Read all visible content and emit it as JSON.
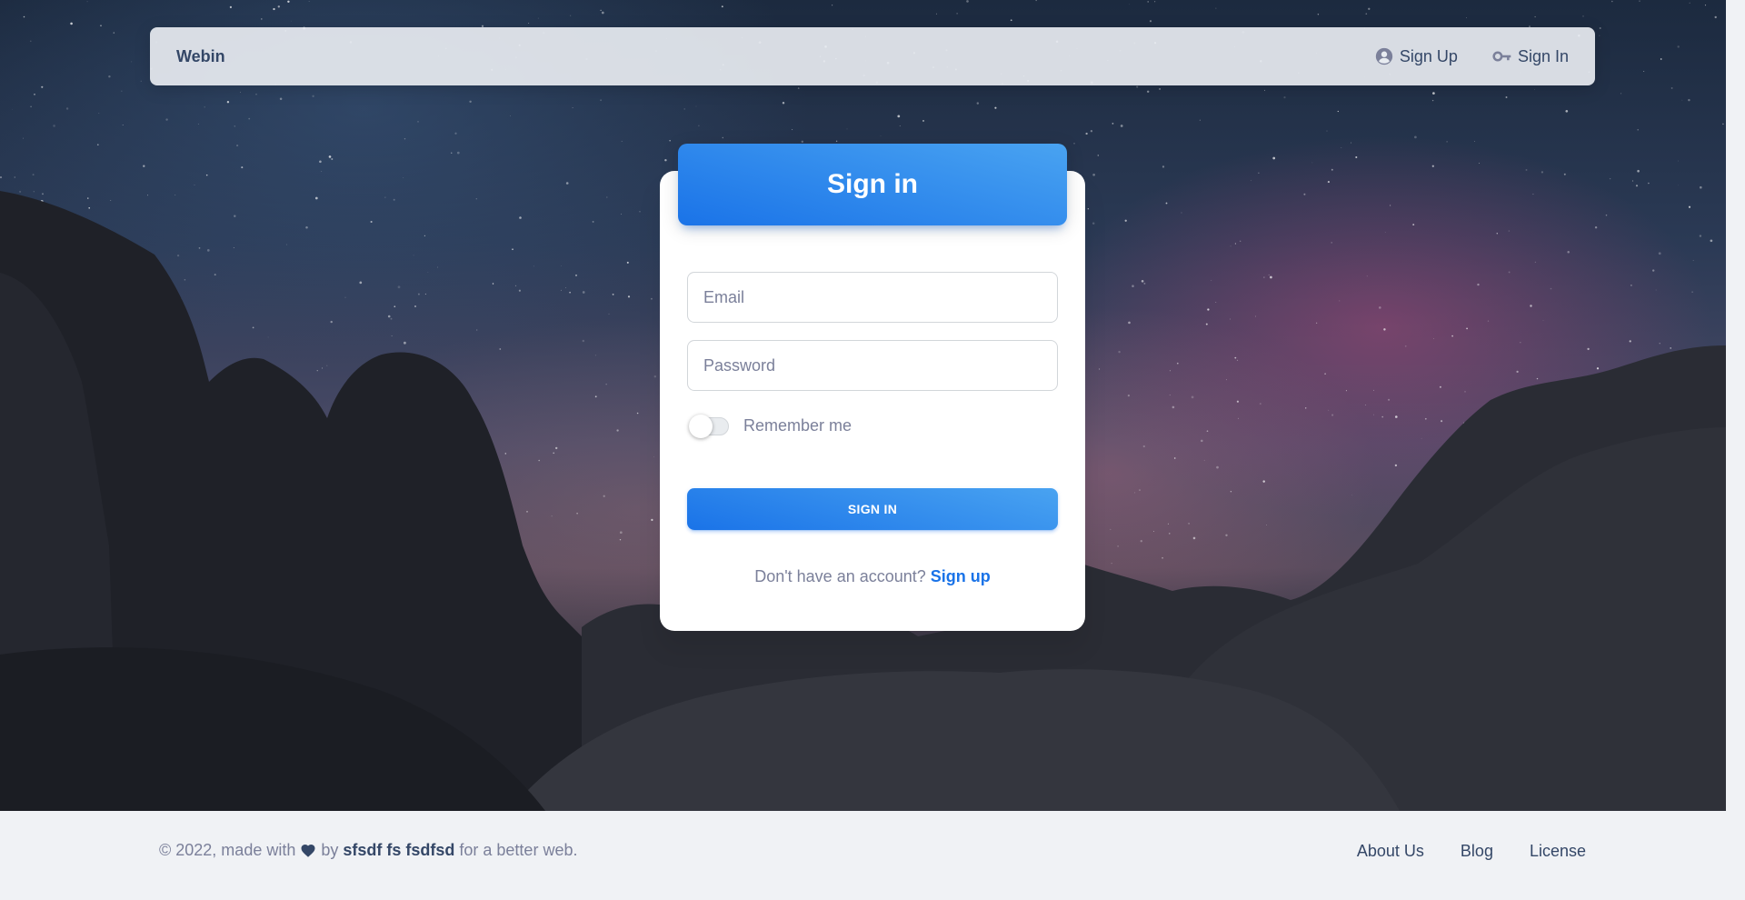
{
  "navbar": {
    "brand": "Webin",
    "links": [
      {
        "label": "Sign Up",
        "icon": "account-circle-icon"
      },
      {
        "label": "Sign In",
        "icon": "key-icon"
      }
    ]
  },
  "card": {
    "title": "Sign in",
    "email_placeholder": "Email",
    "password_placeholder": "Password",
    "remember_label": "Remember me",
    "remember_checked": false,
    "submit_label": "SIGN IN",
    "signup_prompt": "Don't have an account?",
    "signup_link": "Sign up"
  },
  "footer": {
    "copyright_prefix": "© 2022, made with",
    "copyright_by": "by",
    "author": "sfsdf fs fsdfsd",
    "copyright_suffix": "for a better web.",
    "links": [
      "About Us",
      "Blog",
      "License"
    ]
  },
  "colors": {
    "accent_start": "#49a3f1",
    "accent_end": "#1a73e8",
    "text_dark": "#344767",
    "text_muted": "#7b809a"
  }
}
